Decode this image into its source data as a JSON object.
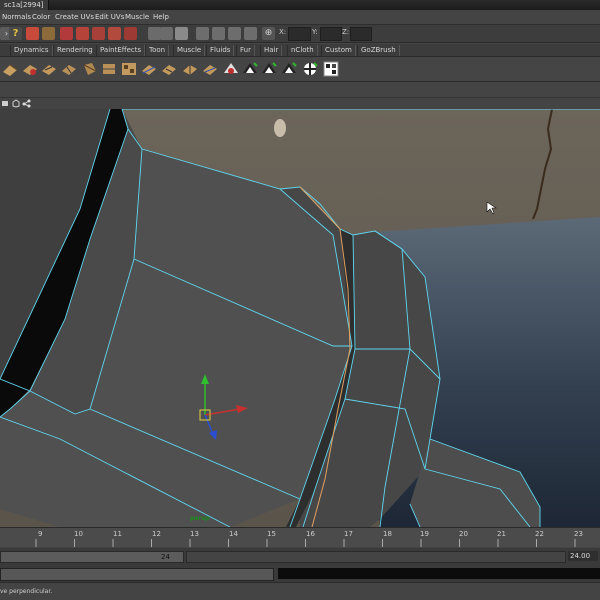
{
  "window": {
    "title": "sc1a[2994]"
  },
  "menu": [
    "Normals",
    "Color",
    "Create UVs",
    "Edit UVs",
    "Muscle",
    "Help"
  ],
  "status_line": {
    "x_label": "X:",
    "y_label": "Y:",
    "z_label": "Z:"
  },
  "shelf_tabs": [
    "Dynamics",
    "Rendering",
    "PaintEffects",
    "Toon",
    "Muscle",
    "Fluids",
    "Fur",
    "Hair",
    "nCloth",
    "Custom",
    "GoZBrush"
  ],
  "viewport": {
    "camera_label": "persp"
  },
  "time_slider": {
    "ticks": [
      "9",
      "10",
      "11",
      "12",
      "13",
      "14",
      "15",
      "16",
      "17",
      "18",
      "19",
      "20",
      "21",
      "22",
      "23"
    ]
  },
  "range_slider": {
    "start": "24",
    "end": "24.00"
  },
  "help_line": {
    "text": "ve perpendicular."
  },
  "colors": {
    "wire": "#5fd6f0",
    "edge_selected": "#e0a060",
    "bg": "#444444"
  }
}
